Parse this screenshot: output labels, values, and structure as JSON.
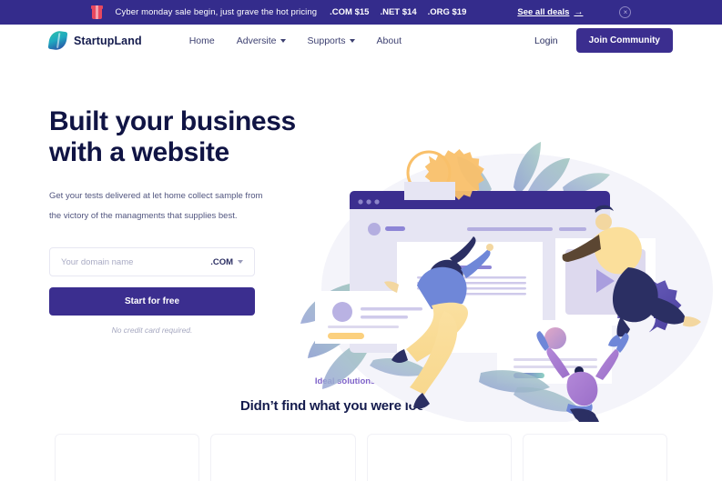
{
  "promo": {
    "icon": "gift-icon",
    "message": "Cyber monday sale begin, just grave the hot pricing",
    "prices": [
      ".COM $15",
      ".NET $14",
      ".ORG $19"
    ],
    "deals_label": "See all deals",
    "deals_arrow": "→",
    "close_label": "×",
    "background": "#342c8c"
  },
  "nav": {
    "brand": "StartupLand",
    "logo_icon": "leaf-logo-icon",
    "links": [
      {
        "label": "Home",
        "has_caret": false
      },
      {
        "label": "Adversite",
        "has_caret": true
      },
      {
        "label": "Supports",
        "has_caret": true
      },
      {
        "label": "About",
        "has_caret": false
      }
    ],
    "login_label": "Login",
    "cta_label": "Join Community",
    "cta_color": "#3b2e8f"
  },
  "hero": {
    "title_line1": "Built your business",
    "title_line2": "with a website",
    "subtitle_line1": "Get your tests delivered at let home collect sample from",
    "subtitle_line2": "the victory of the managments that supplies best.",
    "domain_placeholder": "Your domain name",
    "domain_value": "",
    "tld_selected": ".COM",
    "cta_label": "Start for free",
    "note": "No credit card required.",
    "title_color": "#101444"
  },
  "lower": {
    "eyebrow": "Ideal solutions for you",
    "eyebrow_color": "#7e62c9",
    "title": "Didn’t find what you were looking for?",
    "cards": [
      {
        "id": "card-1"
      },
      {
        "id": "card-2"
      },
      {
        "id": "card-3"
      },
      {
        "id": "card-4"
      }
    ]
  }
}
